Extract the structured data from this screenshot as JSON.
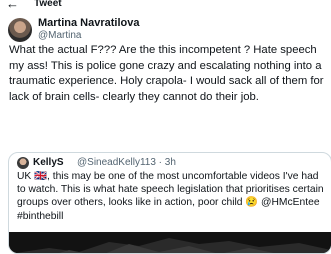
{
  "header": {
    "back_icon": "arrow-left-icon",
    "title": "Tweet"
  },
  "author": {
    "display_name": "Martina Navratilova",
    "handle": "@Martina"
  },
  "tweet": {
    "text": "What the actual F??? Are the this incompetent ? Hate speech my ass! This is police gone crazy and escalating nothing into a traumatic experience. Holy crapola- I would sack all of them for lack of brain cells- clearly they cannot do their job."
  },
  "quoted_tweet": {
    "display_name": "KellyS",
    "handle": "@SineadKelly113 · 3h",
    "text": "UK 🇬🇧, this may be one of the most uncomfortable videos I've had to watch. This is what hate speech legislation that prioritises certain groups over others, looks like in action, poor child 😢 @HMcEntee #binthebill"
  }
}
